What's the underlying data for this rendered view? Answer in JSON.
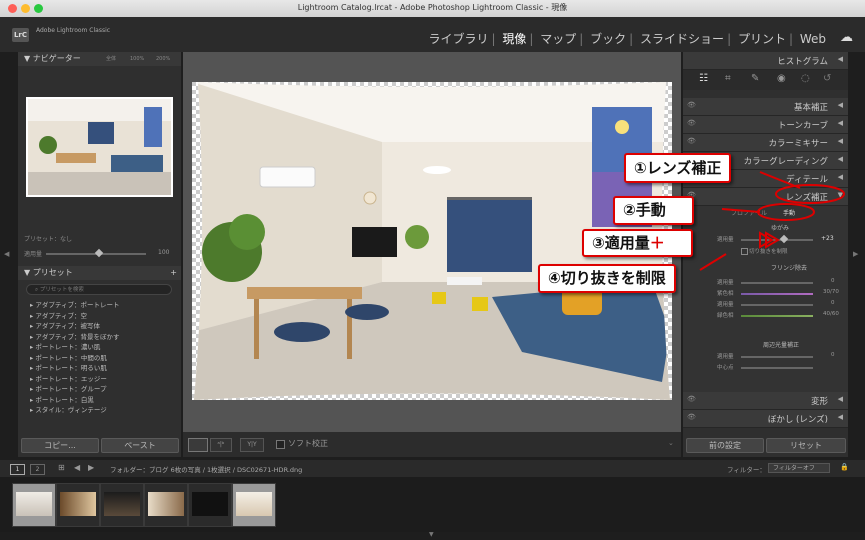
{
  "window": {
    "title": "Lightroom Catalog.lrcat - Adobe Photoshop Lightroom Classic - 現像"
  },
  "identity": {
    "logo": "LrC",
    "app_name": "Adobe Lightroom Classic"
  },
  "modules": [
    "ライブラリ",
    "現像",
    "マップ",
    "ブック",
    "スライドショー",
    "プリント",
    "Web"
  ],
  "active_module": "現像",
  "navigator": {
    "title": "ナビゲーター",
    "zoom_options": [
      "全体",
      "100%",
      "200%"
    ]
  },
  "preset_amount": {
    "label": "プリセット：なし",
    "field_label": "適用量",
    "value": "100"
  },
  "presets": {
    "title": "プリセット",
    "search_placeholder": "プリセットを検索",
    "items": [
      "アダプティブ：ポートレート",
      "アダプティブ：空",
      "アダプティブ：被写体",
      "アダプティブ：背景をぼかす",
      "ポートレート：濃い肌",
      "ポートレート：中間の肌",
      "ポートレート：明るい肌",
      "ポートレート：エッジー",
      "ポートレート：グループ",
      "ポートレート：白黒",
      "スタイル：ヴィンテージ"
    ]
  },
  "left_buttons": {
    "copy": "コピー...",
    "paste": "ペースト"
  },
  "toolbar": {
    "soft_proof": "ソフト校正"
  },
  "histogram": {
    "title": "ヒストグラム"
  },
  "right_panels": [
    "基本補正",
    "トーンカーブ",
    "カラーミキサー",
    "カラーグレーディング",
    "ディテール",
    "レンズ補正"
  ],
  "lens": {
    "tabs": {
      "profile": "プロファイル",
      "manual": "手動"
    },
    "distortion": {
      "title": "ゆがみ",
      "amount_label": "適用量",
      "amount_value": "+23",
      "constrain_crop": "切り抜きを制限"
    },
    "defringe": {
      "title": "フリンジ除去",
      "rows": [
        {
          "label": "適用量",
          "value": "0"
        },
        {
          "label": "紫色相",
          "value": "30/70"
        },
        {
          "label": "適用量",
          "value": "0"
        },
        {
          "label": "緑色相",
          "value": "40/60"
        }
      ]
    },
    "vignette": {
      "title": "周辺光量補正",
      "rows": [
        {
          "label": "適用量",
          "value": "0"
        },
        {
          "label": "中心点",
          "value": ""
        }
      ]
    }
  },
  "right_panels_bottom": [
    "変形",
    "ぼかし (レンズ)"
  ],
  "right_buttons": {
    "previous": "前の設定",
    "reset": "リセット"
  },
  "filmbar": {
    "page1": "1",
    "page2": "2",
    "path": "フォルダー：ブログ  6枚の写真 / 1枚選択 / DSC02671-HDR.dng",
    "filter_label": "フィルター：",
    "filter_value": "フィルターオフ"
  },
  "annotations": [
    "①レンズ補正",
    "②手動",
    "③適用量＋",
    "④切り抜きを制限"
  ],
  "colors": {
    "accent_red": "#dd0000",
    "panel_bg": "#2f2f2f",
    "wall_blue": "#35507c"
  }
}
